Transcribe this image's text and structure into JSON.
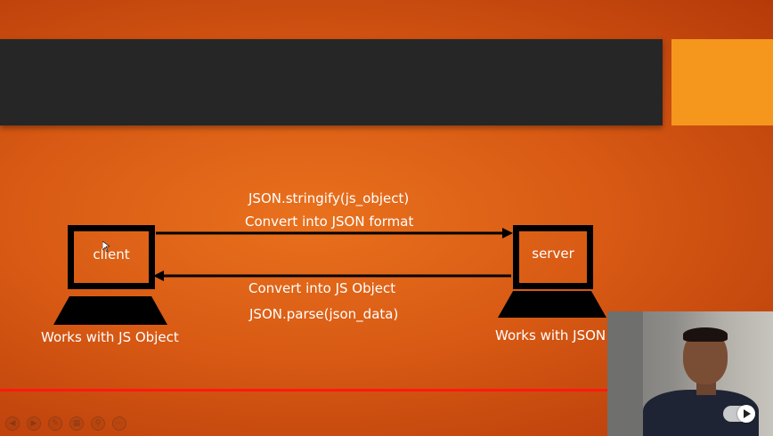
{
  "slide": {
    "client": {
      "label": "client",
      "caption": "Works with JS Object"
    },
    "server": {
      "label": "server",
      "caption": "Works with JSON"
    },
    "to_server": {
      "method": "JSON.stringify(js_object)",
      "description": "Convert into JSON format"
    },
    "to_client": {
      "description": "Convert into JS Object",
      "method": "JSON.parse(json_data)"
    }
  },
  "colors": {
    "background": "#d85a14",
    "title_bar": "#262626",
    "accent": "#f5971d",
    "progress_line": "#ff1a10"
  },
  "toolbar": {
    "icons": [
      "prev-icon",
      "next-icon",
      "pen-icon",
      "slides-icon",
      "zoom-icon",
      "more-icon"
    ]
  },
  "webcam": {
    "controls": [
      "toggle-icon",
      "play-icon"
    ]
  }
}
